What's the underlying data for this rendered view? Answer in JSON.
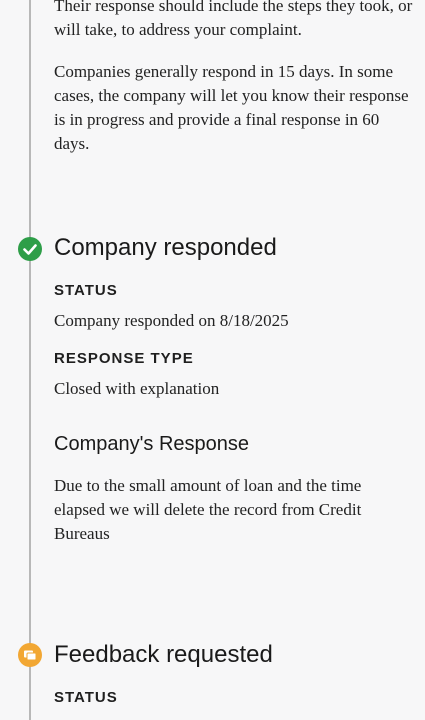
{
  "intro": {
    "paragraph_1": "Their response should include the steps they took, or will take, to address your complaint.",
    "paragraph_2": "Companies generally respond in 15 days. In some cases, the company will let you know their response is in progress and provide a final response in 60 days."
  },
  "step_company_responded": {
    "title": "Company responded",
    "status_label": "STATUS",
    "status_value": "Company responded on 8/18/2025",
    "response_type_label": "RESPONSE TYPE",
    "response_type_value": "Closed with explanation",
    "company_response_heading": "Company's Response",
    "company_response_text": "Due to the small amount of loan and the time elapsed we will delete the record from Credit Bureaus"
  },
  "step_feedback_requested": {
    "title": "Feedback requested",
    "status_label": "STATUS"
  },
  "colors": {
    "completed_icon": "#2e9e48",
    "pending_icon": "#f2a733",
    "timeline_line": "#b8b8b8",
    "background": "#f7f7f8"
  },
  "icons": {
    "completed": "check-icon",
    "pending": "feedback-icon"
  }
}
